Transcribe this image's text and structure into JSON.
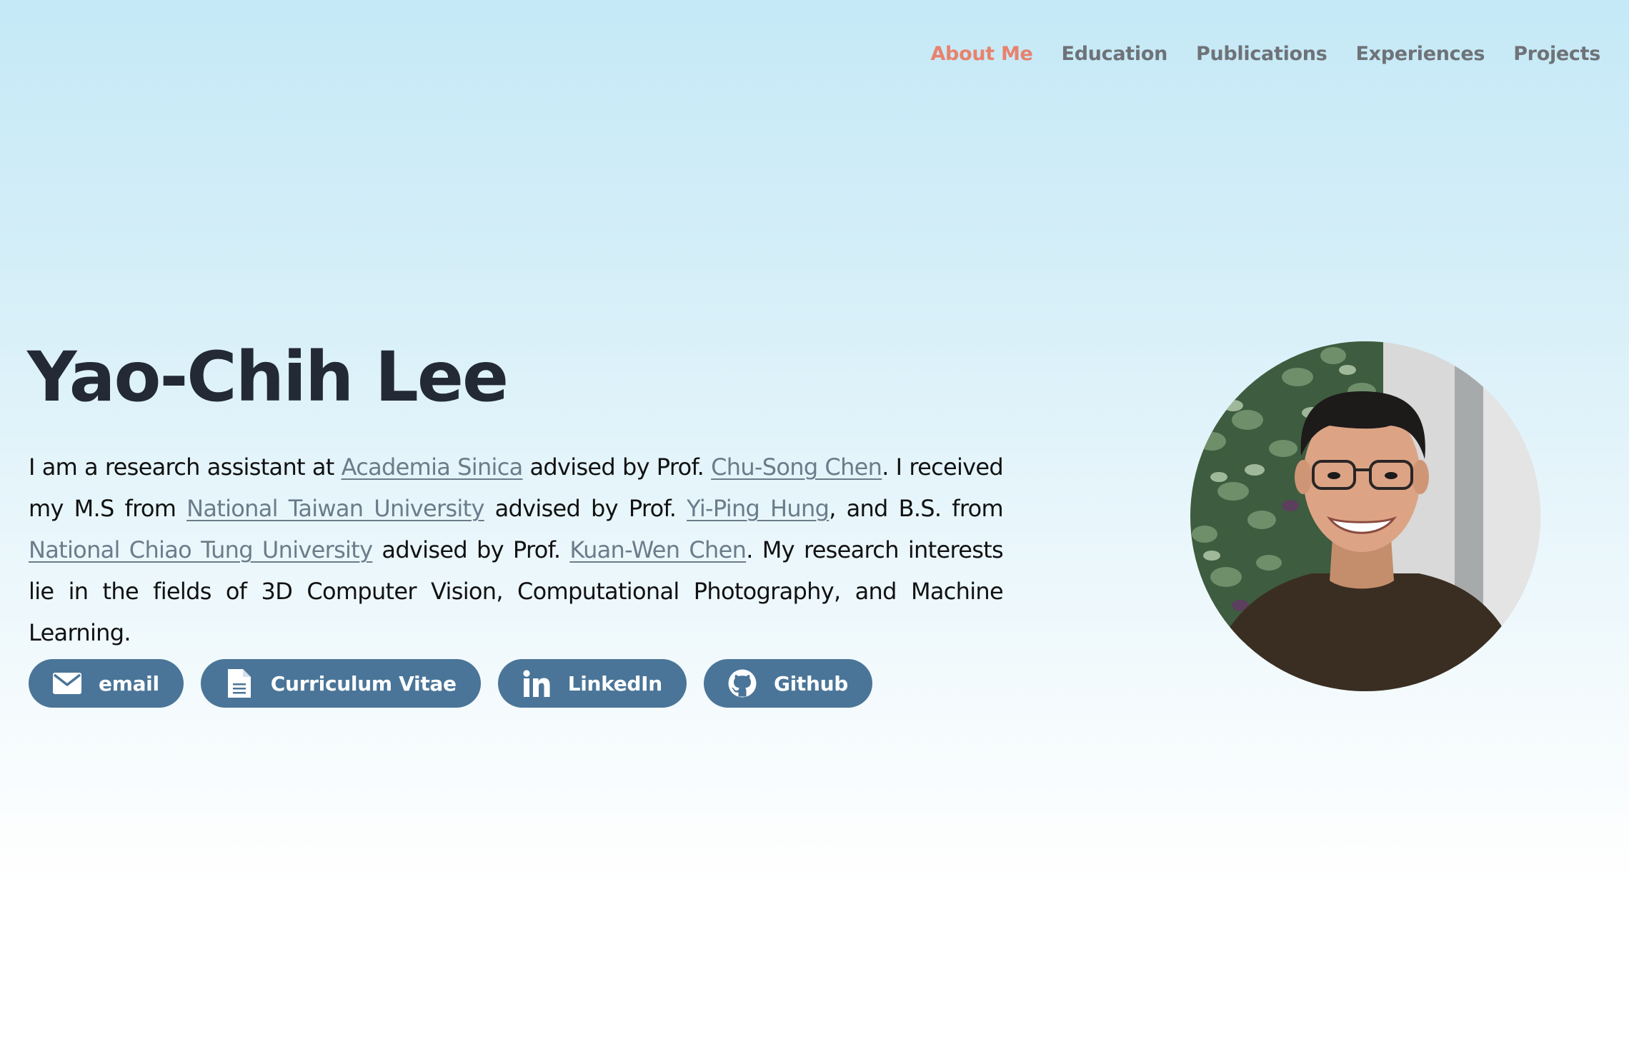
{
  "nav": {
    "items": [
      {
        "label": "About Me",
        "active": true
      },
      {
        "label": "Education",
        "active": false
      },
      {
        "label": "Publications",
        "active": false
      },
      {
        "label": "Experiences",
        "active": false
      },
      {
        "label": "Projects",
        "active": false
      }
    ]
  },
  "hero": {
    "name": "Yao-Chih Lee",
    "bio": {
      "t1": "I am a research assistant at ",
      "link1": "Academia Sinica",
      "t2": " advised by Prof. ",
      "link2": "Chu-Song Chen",
      "t3": ". I received my M.S from ",
      "link3": "National Taiwan University",
      "t4": " advised by Prof. ",
      "link4": "Yi-Ping Hung",
      "t5": ", and B.S. from ",
      "link5": "National Chiao Tung University",
      "t6": " advised by Prof. ",
      "link6": "Kuan-Wen Chen",
      "t7": ". My research interests lie in the fields of 3D Computer Vision, Computational Photography, and Machine Learning."
    }
  },
  "buttons": [
    {
      "label": "email",
      "icon": "envelope-icon"
    },
    {
      "label": "Curriculum Vitae",
      "icon": "document-icon"
    },
    {
      "label": "LinkedIn",
      "icon": "linkedin-icon"
    },
    {
      "label": "Github",
      "icon": "github-icon"
    }
  ],
  "colors": {
    "accent": "#e8826e",
    "nav_text": "#6e7378",
    "button_bg": "#4a7598",
    "heading": "#232a35",
    "link": "#6b7c8a"
  }
}
